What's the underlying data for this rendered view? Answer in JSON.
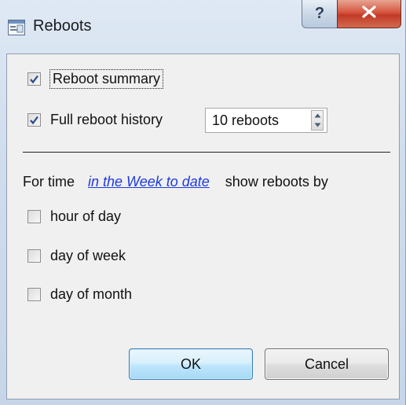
{
  "window": {
    "title": "Reboots",
    "help_glyph": "?",
    "close_icon": "close-icon"
  },
  "options": {
    "reboot_summary": {
      "label": "Reboot summary",
      "checked": true
    },
    "full_history": {
      "label": "Full reboot history",
      "checked": true,
      "count_value": "10 reboots"
    }
  },
  "time_filter": {
    "prefix": "For time",
    "period_link": "in the Week to date",
    "suffix": "show reboots by"
  },
  "group_by": [
    {
      "label": "hour of day",
      "checked": false
    },
    {
      "label": "day of week",
      "checked": false
    },
    {
      "label": "day of month",
      "checked": false
    }
  ],
  "buttons": {
    "ok": "OK",
    "cancel": "Cancel"
  },
  "colors": {
    "link": "#1f3bdc",
    "close_button": "#c23a26",
    "checkmark": "#2a4a8a"
  }
}
